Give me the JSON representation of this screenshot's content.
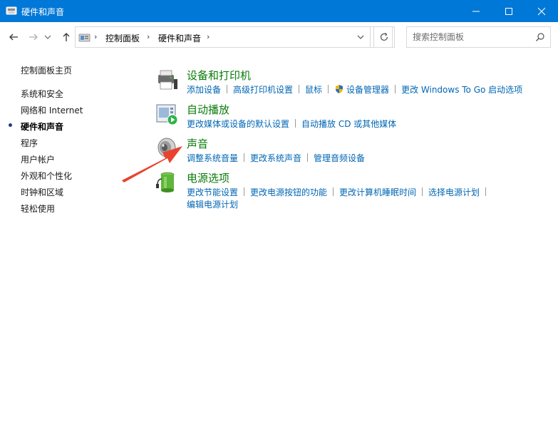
{
  "window": {
    "title": "硬件和声音",
    "icon": "control-panel-icon",
    "controls": [
      "minimize-icon",
      "maximize-icon",
      "close-icon"
    ]
  },
  "nav": {
    "breadcrumb": [
      "控制面板",
      "硬件和声音"
    ],
    "search_placeholder": "搜索控制面板"
  },
  "sidebar": {
    "items": [
      {
        "label": "控制面板主页",
        "active": false
      },
      {
        "label": "系统和安全",
        "active": false
      },
      {
        "label": "网络和 Internet",
        "active": false
      },
      {
        "label": "硬件和声音",
        "active": true
      },
      {
        "label": "程序",
        "active": false
      },
      {
        "label": "用户帐户",
        "active": false
      },
      {
        "label": "外观和个性化",
        "active": false
      },
      {
        "label": "时钟和区域",
        "active": false
      },
      {
        "label": "轻松使用",
        "active": false
      }
    ]
  },
  "categories": {
    "devices": {
      "title": "设备和打印机",
      "icon": "printer-icon",
      "links": [
        "添加设备",
        "高级打印机设置",
        "鼠标",
        "设备管理器",
        "更改 Windows To Go 启动选项"
      ]
    },
    "autoplay": {
      "title": "自动播放",
      "icon": "autoplay-icon",
      "links": [
        "更改媒体或设备的默认设置",
        "自动播放 CD 或其他媒体"
      ]
    },
    "sound": {
      "title": "声音",
      "icon": "speaker-icon",
      "links": [
        "调整系统音量",
        "更改系统声音",
        "管理音频设备"
      ]
    },
    "power": {
      "title": "电源选项",
      "icon": "battery-icon",
      "links": [
        "更改节能设置",
        "更改电源按钮的功能",
        "更改计算机睡眠时间",
        "选择电源计划",
        "编辑电源计划"
      ]
    }
  },
  "colors": {
    "titlebar": "#0078d7",
    "heading_green": "#0a7b0a",
    "link_blue": "#0066b4",
    "annotation_arrow": "#e8432f"
  }
}
